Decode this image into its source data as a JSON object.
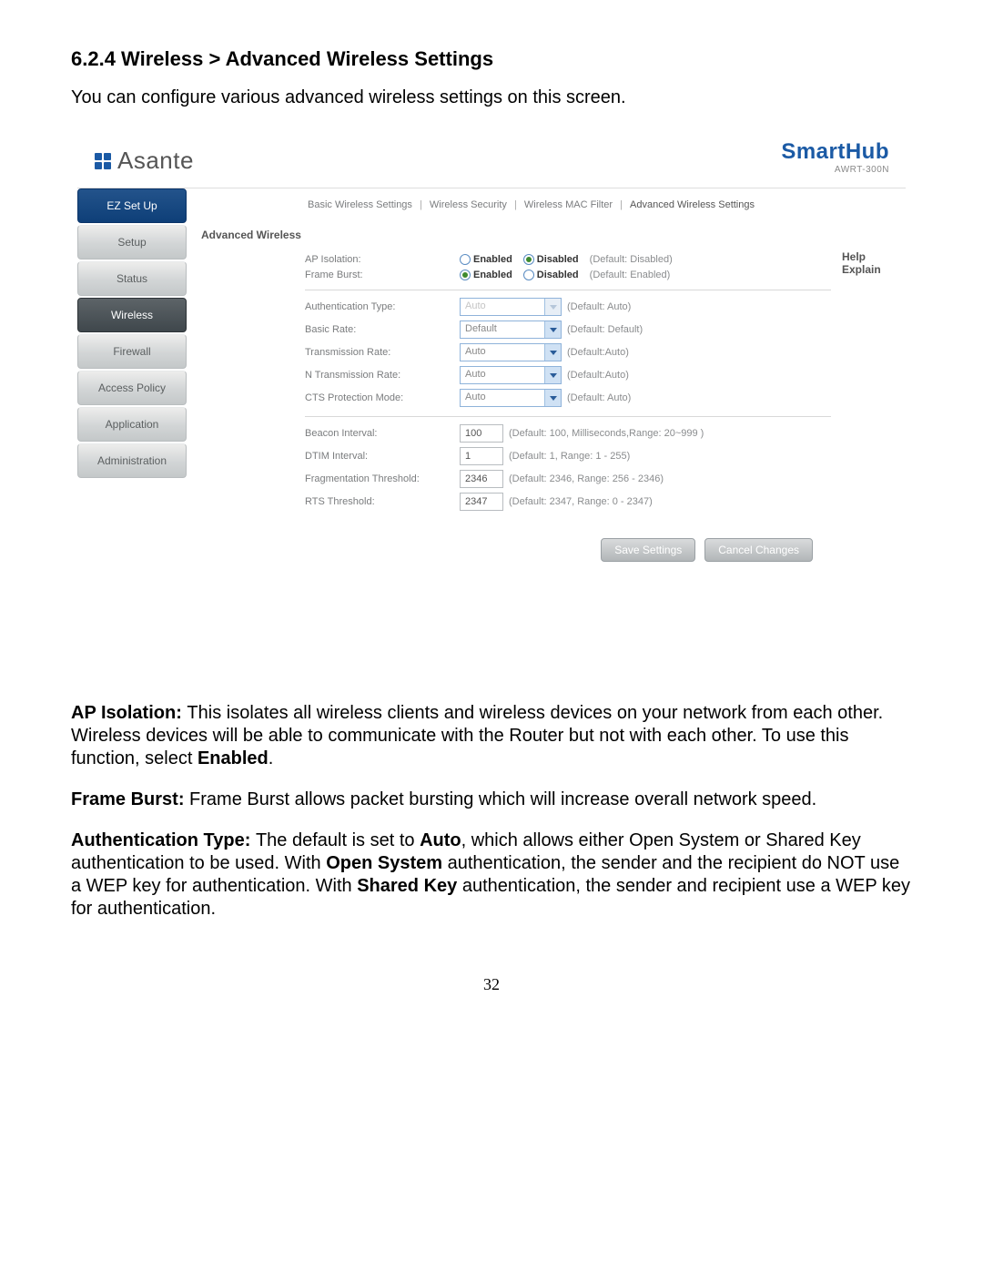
{
  "doc": {
    "heading": "6.2.4 Wireless > Advanced Wireless Settings",
    "intro": "You can configure various advanced wireless settings on this screen.",
    "page_number": "32"
  },
  "brand": {
    "company": "Asante",
    "product": "SmartHub",
    "model": "AWRT-300N"
  },
  "sidebar": {
    "items": [
      {
        "label": "EZ Set Up",
        "kind": "primary"
      },
      {
        "label": "Setup",
        "kind": "normal"
      },
      {
        "label": "Status",
        "kind": "normal"
      },
      {
        "label": "Wireless",
        "kind": "active"
      },
      {
        "label": "Firewall",
        "kind": "normal"
      },
      {
        "label": "Access Policy",
        "kind": "normal"
      },
      {
        "label": "Application",
        "kind": "normal"
      },
      {
        "label": "Administration",
        "kind": "normal"
      }
    ]
  },
  "subnav": {
    "items": [
      "Basic Wireless Settings",
      "Wireless Security",
      "Wireless MAC Filter",
      "Advanced Wireless Settings"
    ],
    "sep": "|",
    "active_index": 3
  },
  "panel": {
    "section_title": "Advanced Wireless",
    "help_title": "Help",
    "help_link": "Explain"
  },
  "form": {
    "ap_isolation": {
      "label": "AP Isolation:",
      "opt_enabled": "Enabled",
      "opt_disabled": "Disabled",
      "hint": "(Default: Disabled)",
      "selected": "disabled"
    },
    "frame_burst": {
      "label": "Frame Burst:",
      "opt_enabled": "Enabled",
      "opt_disabled": "Disabled",
      "hint": "(Default: Enabled)",
      "selected": "enabled"
    },
    "auth_type": {
      "label": "Authentication Type:",
      "value": "Auto",
      "hint": "(Default: Auto)",
      "disabled": true
    },
    "basic_rate": {
      "label": "Basic Rate:",
      "value": "Default",
      "hint": "(Default: Default)",
      "disabled": false
    },
    "tx_rate": {
      "label": "Transmission Rate:",
      "value": "Auto",
      "hint": "(Default:Auto)",
      "disabled": false
    },
    "n_tx_rate": {
      "label": "N Transmission Rate:",
      "value": "Auto",
      "hint": "(Default:Auto)",
      "disabled": false
    },
    "cts_mode": {
      "label": "CTS Protection Mode:",
      "value": "Auto",
      "hint": "(Default: Auto)",
      "disabled": false
    },
    "beacon": {
      "label": "Beacon Interval:",
      "value": "100",
      "hint": "(Default: 100, Milliseconds,Range: 20~999 )"
    },
    "dtim": {
      "label": "DTIM Interval:",
      "value": "1",
      "hint": "(Default: 1, Range: 1 - 255)"
    },
    "frag": {
      "label": "Fragmentation Threshold:",
      "value": "2346",
      "hint": "(Default: 2346, Range: 256 - 2346)"
    },
    "rts": {
      "label": "RTS Threshold:",
      "value": "2347",
      "hint": "(Default: 2347, Range: 0 - 2347)"
    }
  },
  "actions": {
    "save": "Save Settings",
    "cancel": "Cancel Changes"
  },
  "desc": {
    "p1_bold": "AP Isolation: ",
    "p1_rest_a": "This isolates all wireless clients and wireless devices on your network from each other. Wireless devices will be able to communicate with the Router but not with each other. To use this function, select ",
    "p1_rest_b": "Enabled",
    "p1_rest_c": ".",
    "p2_bold": "Frame Burst: ",
    "p2_rest": "Frame Burst allows packet bursting which will increase overall network speed.",
    "p3_bold": "Authentication Type: ",
    "p3_rest_a": "The default is set to ",
    "p3_rest_b": "Auto",
    "p3_rest_c": ", which allows either Open System or Shared Key authentication to be used. With ",
    "p3_rest_d": "Open System",
    "p3_rest_e": " authentication, the sender and the recipient do NOT use a WEP key for authentication. With ",
    "p3_rest_f": "Shared Key",
    "p3_rest_g": " authentication, the sender and recipient use a WEP key for authentication."
  }
}
